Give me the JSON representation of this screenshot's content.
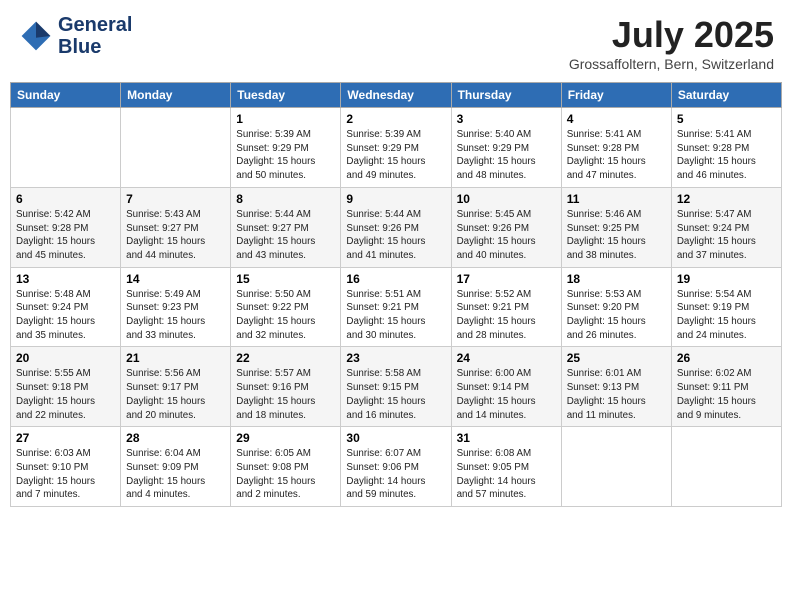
{
  "header": {
    "logo_line1": "General",
    "logo_line2": "Blue",
    "month": "July 2025",
    "location": "Grossaffoltern, Bern, Switzerland"
  },
  "weekdays": [
    "Sunday",
    "Monday",
    "Tuesday",
    "Wednesday",
    "Thursday",
    "Friday",
    "Saturday"
  ],
  "weeks": [
    [
      {
        "day": "",
        "info": ""
      },
      {
        "day": "",
        "info": ""
      },
      {
        "day": "1",
        "info": "Sunrise: 5:39 AM\nSunset: 9:29 PM\nDaylight: 15 hours\nand 50 minutes."
      },
      {
        "day": "2",
        "info": "Sunrise: 5:39 AM\nSunset: 9:29 PM\nDaylight: 15 hours\nand 49 minutes."
      },
      {
        "day": "3",
        "info": "Sunrise: 5:40 AM\nSunset: 9:29 PM\nDaylight: 15 hours\nand 48 minutes."
      },
      {
        "day": "4",
        "info": "Sunrise: 5:41 AM\nSunset: 9:28 PM\nDaylight: 15 hours\nand 47 minutes."
      },
      {
        "day": "5",
        "info": "Sunrise: 5:41 AM\nSunset: 9:28 PM\nDaylight: 15 hours\nand 46 minutes."
      }
    ],
    [
      {
        "day": "6",
        "info": "Sunrise: 5:42 AM\nSunset: 9:28 PM\nDaylight: 15 hours\nand 45 minutes."
      },
      {
        "day": "7",
        "info": "Sunrise: 5:43 AM\nSunset: 9:27 PM\nDaylight: 15 hours\nand 44 minutes."
      },
      {
        "day": "8",
        "info": "Sunrise: 5:44 AM\nSunset: 9:27 PM\nDaylight: 15 hours\nand 43 minutes."
      },
      {
        "day": "9",
        "info": "Sunrise: 5:44 AM\nSunset: 9:26 PM\nDaylight: 15 hours\nand 41 minutes."
      },
      {
        "day": "10",
        "info": "Sunrise: 5:45 AM\nSunset: 9:26 PM\nDaylight: 15 hours\nand 40 minutes."
      },
      {
        "day": "11",
        "info": "Sunrise: 5:46 AM\nSunset: 9:25 PM\nDaylight: 15 hours\nand 38 minutes."
      },
      {
        "day": "12",
        "info": "Sunrise: 5:47 AM\nSunset: 9:24 PM\nDaylight: 15 hours\nand 37 minutes."
      }
    ],
    [
      {
        "day": "13",
        "info": "Sunrise: 5:48 AM\nSunset: 9:24 PM\nDaylight: 15 hours\nand 35 minutes."
      },
      {
        "day": "14",
        "info": "Sunrise: 5:49 AM\nSunset: 9:23 PM\nDaylight: 15 hours\nand 33 minutes."
      },
      {
        "day": "15",
        "info": "Sunrise: 5:50 AM\nSunset: 9:22 PM\nDaylight: 15 hours\nand 32 minutes."
      },
      {
        "day": "16",
        "info": "Sunrise: 5:51 AM\nSunset: 9:21 PM\nDaylight: 15 hours\nand 30 minutes."
      },
      {
        "day": "17",
        "info": "Sunrise: 5:52 AM\nSunset: 9:21 PM\nDaylight: 15 hours\nand 28 minutes."
      },
      {
        "day": "18",
        "info": "Sunrise: 5:53 AM\nSunset: 9:20 PM\nDaylight: 15 hours\nand 26 minutes."
      },
      {
        "day": "19",
        "info": "Sunrise: 5:54 AM\nSunset: 9:19 PM\nDaylight: 15 hours\nand 24 minutes."
      }
    ],
    [
      {
        "day": "20",
        "info": "Sunrise: 5:55 AM\nSunset: 9:18 PM\nDaylight: 15 hours\nand 22 minutes."
      },
      {
        "day": "21",
        "info": "Sunrise: 5:56 AM\nSunset: 9:17 PM\nDaylight: 15 hours\nand 20 minutes."
      },
      {
        "day": "22",
        "info": "Sunrise: 5:57 AM\nSunset: 9:16 PM\nDaylight: 15 hours\nand 18 minutes."
      },
      {
        "day": "23",
        "info": "Sunrise: 5:58 AM\nSunset: 9:15 PM\nDaylight: 15 hours\nand 16 minutes."
      },
      {
        "day": "24",
        "info": "Sunrise: 6:00 AM\nSunset: 9:14 PM\nDaylight: 15 hours\nand 14 minutes."
      },
      {
        "day": "25",
        "info": "Sunrise: 6:01 AM\nSunset: 9:13 PM\nDaylight: 15 hours\nand 11 minutes."
      },
      {
        "day": "26",
        "info": "Sunrise: 6:02 AM\nSunset: 9:11 PM\nDaylight: 15 hours\nand 9 minutes."
      }
    ],
    [
      {
        "day": "27",
        "info": "Sunrise: 6:03 AM\nSunset: 9:10 PM\nDaylight: 15 hours\nand 7 minutes."
      },
      {
        "day": "28",
        "info": "Sunrise: 6:04 AM\nSunset: 9:09 PM\nDaylight: 15 hours\nand 4 minutes."
      },
      {
        "day": "29",
        "info": "Sunrise: 6:05 AM\nSunset: 9:08 PM\nDaylight: 15 hours\nand 2 minutes."
      },
      {
        "day": "30",
        "info": "Sunrise: 6:07 AM\nSunset: 9:06 PM\nDaylight: 14 hours\nand 59 minutes."
      },
      {
        "day": "31",
        "info": "Sunrise: 6:08 AM\nSunset: 9:05 PM\nDaylight: 14 hours\nand 57 minutes."
      },
      {
        "day": "",
        "info": ""
      },
      {
        "day": "",
        "info": ""
      }
    ]
  ]
}
